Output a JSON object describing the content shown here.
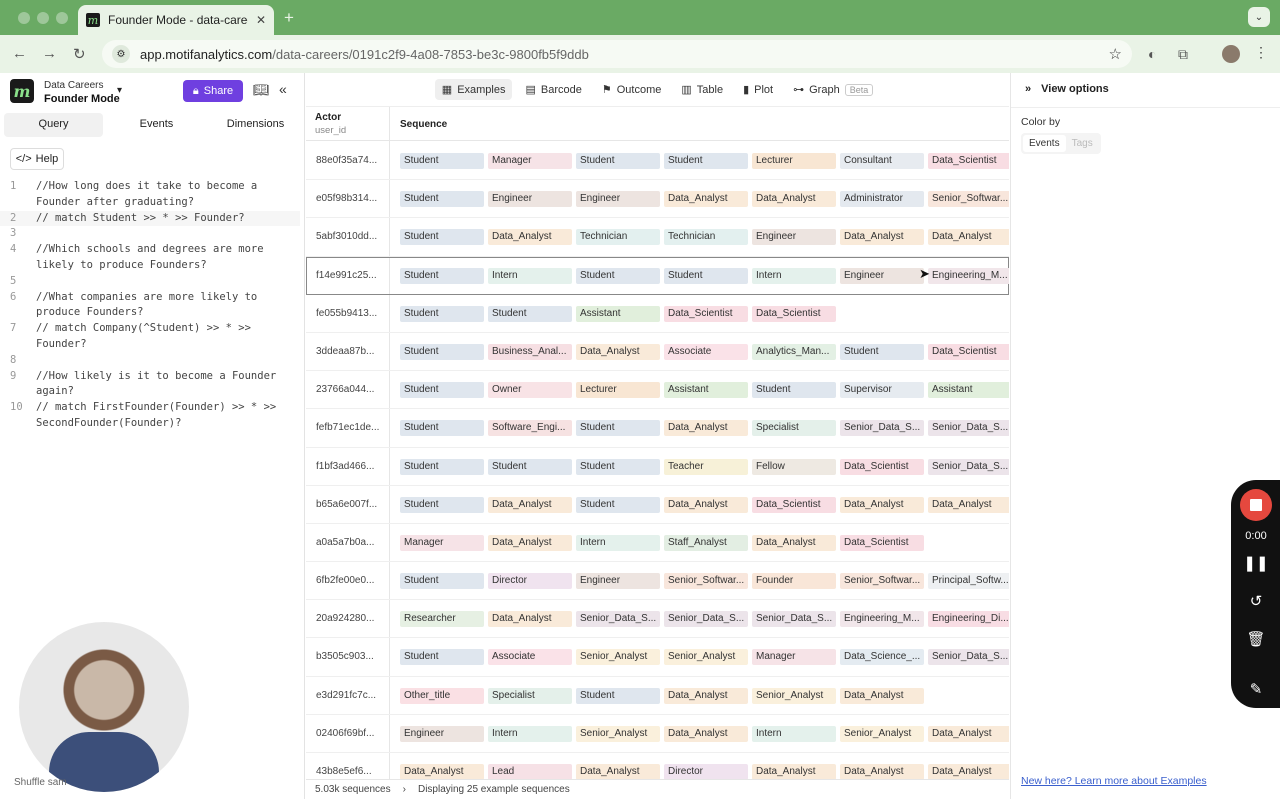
{
  "browser": {
    "tab_title": "Founder Mode - data-careers",
    "url_host": "app.motifanalytics.com",
    "url_path": "/data-careers/0191c2f9-4a08-7853-be3c-9800fb5f9ddb"
  },
  "project": {
    "name": "Data Careers",
    "view": "Founder Mode"
  },
  "sidebar": {
    "share_label": "Share",
    "tabs": [
      "Query",
      "Events",
      "Dimensions"
    ],
    "help_label": "Help",
    "code_lines": [
      {
        "n": "1",
        "text": "//How long does it take to become a\nFounder after graduating?"
      },
      {
        "n": "2",
        "text": "// match Student >> * >> Founder?"
      },
      {
        "n": "3",
        "text": ""
      },
      {
        "n": "4",
        "text": "//Which schools and degrees are more\nlikely to produce Founders?"
      },
      {
        "n": "5",
        "text": ""
      },
      {
        "n": "6",
        "text": "//What companies are more likely to\nproduce Founders?"
      },
      {
        "n": "7",
        "text": "// match Company(^Student) >> * >>\nFounder?"
      },
      {
        "n": "8",
        "text": ""
      },
      {
        "n": "9",
        "text": "//How likely is it to become a Founder\nagain?"
      },
      {
        "n": "10",
        "text": "// match FirstFounder(Founder) >> * >>\nSecondFounder(Founder)?"
      }
    ],
    "shuffle_label": "Shuffle sam"
  },
  "toolbar": {
    "tabs": [
      "Examples",
      "Barcode",
      "Outcome",
      "Table",
      "Plot",
      "Graph"
    ],
    "beta_label": "Beta"
  },
  "table": {
    "col_actor": "Actor",
    "col_actor_sub": "user_id",
    "col_sequence": "Sequence",
    "rows": [
      {
        "id": "88e0f35a74...",
        "seq": [
          "Student",
          "Manager",
          "Student",
          "Student",
          "Lecturer",
          "Consultant",
          "Data_Scientist"
        ]
      },
      {
        "id": "e05f98b314...",
        "seq": [
          "Student",
          "Engineer",
          "Engineer",
          "Data_Analyst",
          "Data_Analyst",
          "Administrator",
          "Senior_Softwar..."
        ]
      },
      {
        "id": "5abf3010dd...",
        "seq": [
          "Student",
          "Data_Analyst",
          "Technician",
          "Technician",
          "Engineer",
          "Data_Analyst",
          "Data_Analyst"
        ]
      },
      {
        "id": "f14e991c25...",
        "seq": [
          "Student",
          "Intern",
          "Student",
          "Student",
          "Intern",
          "Engineer",
          "Engineering_M..."
        ]
      },
      {
        "id": "fe055b9413...",
        "seq": [
          "Student",
          "Student",
          "Assistant",
          "Data_Scientist",
          "Data_Scientist"
        ]
      },
      {
        "id": "3ddeaa87b...",
        "seq": [
          "Student",
          "Business_Anal...",
          "Data_Analyst",
          "Associate",
          "Analytics_Man...",
          "Student",
          "Data_Scientist"
        ]
      },
      {
        "id": "23766a044...",
        "seq": [
          "Student",
          "Owner",
          "Lecturer",
          "Assistant",
          "Student",
          "Supervisor",
          "Assistant"
        ]
      },
      {
        "id": "fefb71ec1de...",
        "seq": [
          "Student",
          "Software_Engi...",
          "Student",
          "Data_Analyst",
          "Specialist",
          "Senior_Data_S...",
          "Senior_Data_S..."
        ]
      },
      {
        "id": "f1bf3ad466...",
        "seq": [
          "Student",
          "Student",
          "Student",
          "Teacher",
          "Fellow",
          "Data_Scientist",
          "Senior_Data_S..."
        ]
      },
      {
        "id": "b65a6e007f...",
        "seq": [
          "Student",
          "Data_Analyst",
          "Student",
          "Data_Analyst",
          "Data_Scientist",
          "Data_Analyst",
          "Data_Analyst"
        ]
      },
      {
        "id": "a0a5a7b0a...",
        "seq": [
          "Manager",
          "Data_Analyst",
          "Intern",
          "Staff_Analyst",
          "Data_Analyst",
          "Data_Scientist"
        ]
      },
      {
        "id": "6fb2fe00e0...",
        "seq": [
          "Student",
          "Director",
          "Engineer",
          "Senior_Softwar...",
          "Founder",
          "Senior_Softwar...",
          "Principal_Softw..."
        ]
      },
      {
        "id": "20a924280...",
        "seq": [
          "Researcher",
          "Data_Analyst",
          "Senior_Data_S...",
          "Senior_Data_S...",
          "Senior_Data_S...",
          "Engineering_M...",
          "Engineering_Di..."
        ]
      },
      {
        "id": "b3505c903...",
        "seq": [
          "Student",
          "Associate",
          "Senior_Analyst",
          "Senior_Analyst",
          "Manager",
          "Data_Science_...",
          "Senior_Data_S..."
        ]
      },
      {
        "id": "e3d291fc7c...",
        "seq": [
          "Other_title",
          "Specialist",
          "Student",
          "Data_Analyst",
          "Senior_Analyst",
          "Data_Analyst"
        ]
      },
      {
        "id": "02406f69bf...",
        "seq": [
          "Engineer",
          "Intern",
          "Senior_Analyst",
          "Data_Analyst",
          "Intern",
          "Senior_Analyst",
          "Data_Analyst"
        ]
      },
      {
        "id": "43b8e5ef6...",
        "seq": [
          "Data_Analyst",
          "Lead",
          "Data_Analyst",
          "Director",
          "Data_Analyst",
          "Data_Analyst",
          "Data_Analyst"
        ]
      }
    ],
    "footer_count": "5.03k sequences",
    "footer_desc": "Displaying 25 example sequences"
  },
  "view_options": {
    "title": "View options",
    "color_by_label": "Color by",
    "color_by_options": [
      "Events",
      "Tags"
    ],
    "learn_link": "New here? Learn more about Examples"
  },
  "recorder": {
    "time": "0:00"
  },
  "chip_colors": {
    "Student": "#dfe6ee",
    "Manager": "#f6e3e7",
    "Lecturer": "#f8e6d3",
    "Consultant": "#e7ebf0",
    "Data_Scientist": "#f8dde3",
    "Engineer": "#ede4e0",
    "Data_Analyst": "#f9ead9",
    "Administrator": "#e4e9ef",
    "Senior_Softwar...": "#f8e6dc",
    "Technician": "#e3f0ef",
    "Intern": "#e4f1ec",
    "Engineering_M...": "#f1e6ea",
    "Assistant": "#e1efdc",
    "Business_Anal...": "#f6dfe3",
    "Associate": "#fae2e8",
    "Analytics_Man...": "#e3f0e4",
    "Owner": "#f8e3e6",
    "Supervisor": "#e6ebf0",
    "Software_Engi...": "#f6e2e2",
    "Specialist": "#e4f0ea",
    "Senior_Data_S...": "#ece4ea",
    "Teacher": "#f7f1d8",
    "Fellow": "#eee9e2",
    "Staff_Analyst": "#e3eee3",
    "Director": "#f0e3ef",
    "Founder": "#f9e6d8",
    "Principal_Softw...": "#eef0f2",
    "Researcher": "#e6f0e3",
    "Engineering_Di...": "#f8dde4",
    "Senior_Analyst": "#faf0dc",
    "Data_Science_...": "#e4ebf1",
    "Other_title": "#fae0e4",
    "Lead": "#f6e1e6"
  }
}
